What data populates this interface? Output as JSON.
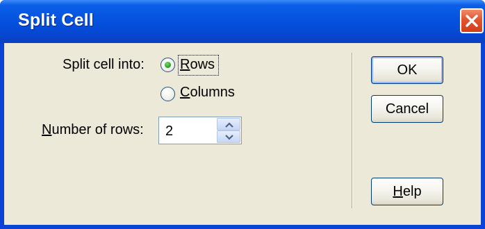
{
  "window": {
    "title": "Split Cell"
  },
  "form": {
    "split_label": "Split cell into:",
    "options": [
      {
        "label_access": "R",
        "label_rest": "ows",
        "selected": true
      },
      {
        "label_access": "C",
        "label_rest": "olumns",
        "selected": false
      }
    ],
    "number_label_access": "N",
    "number_label_rest": "umber of rows:",
    "number_value": "2"
  },
  "buttons": {
    "ok": "OK",
    "cancel": "Cancel",
    "help_access": "H",
    "help_rest": "elp"
  },
  "icons": {
    "close": "close-icon",
    "spin_up": "chevron-up-icon",
    "spin_down": "chevron-down-icon"
  },
  "colors": {
    "titlebar": "#0553e0",
    "client": "#ece9d8",
    "close_button": "#e2532d",
    "radio_selected": "#29a329"
  }
}
